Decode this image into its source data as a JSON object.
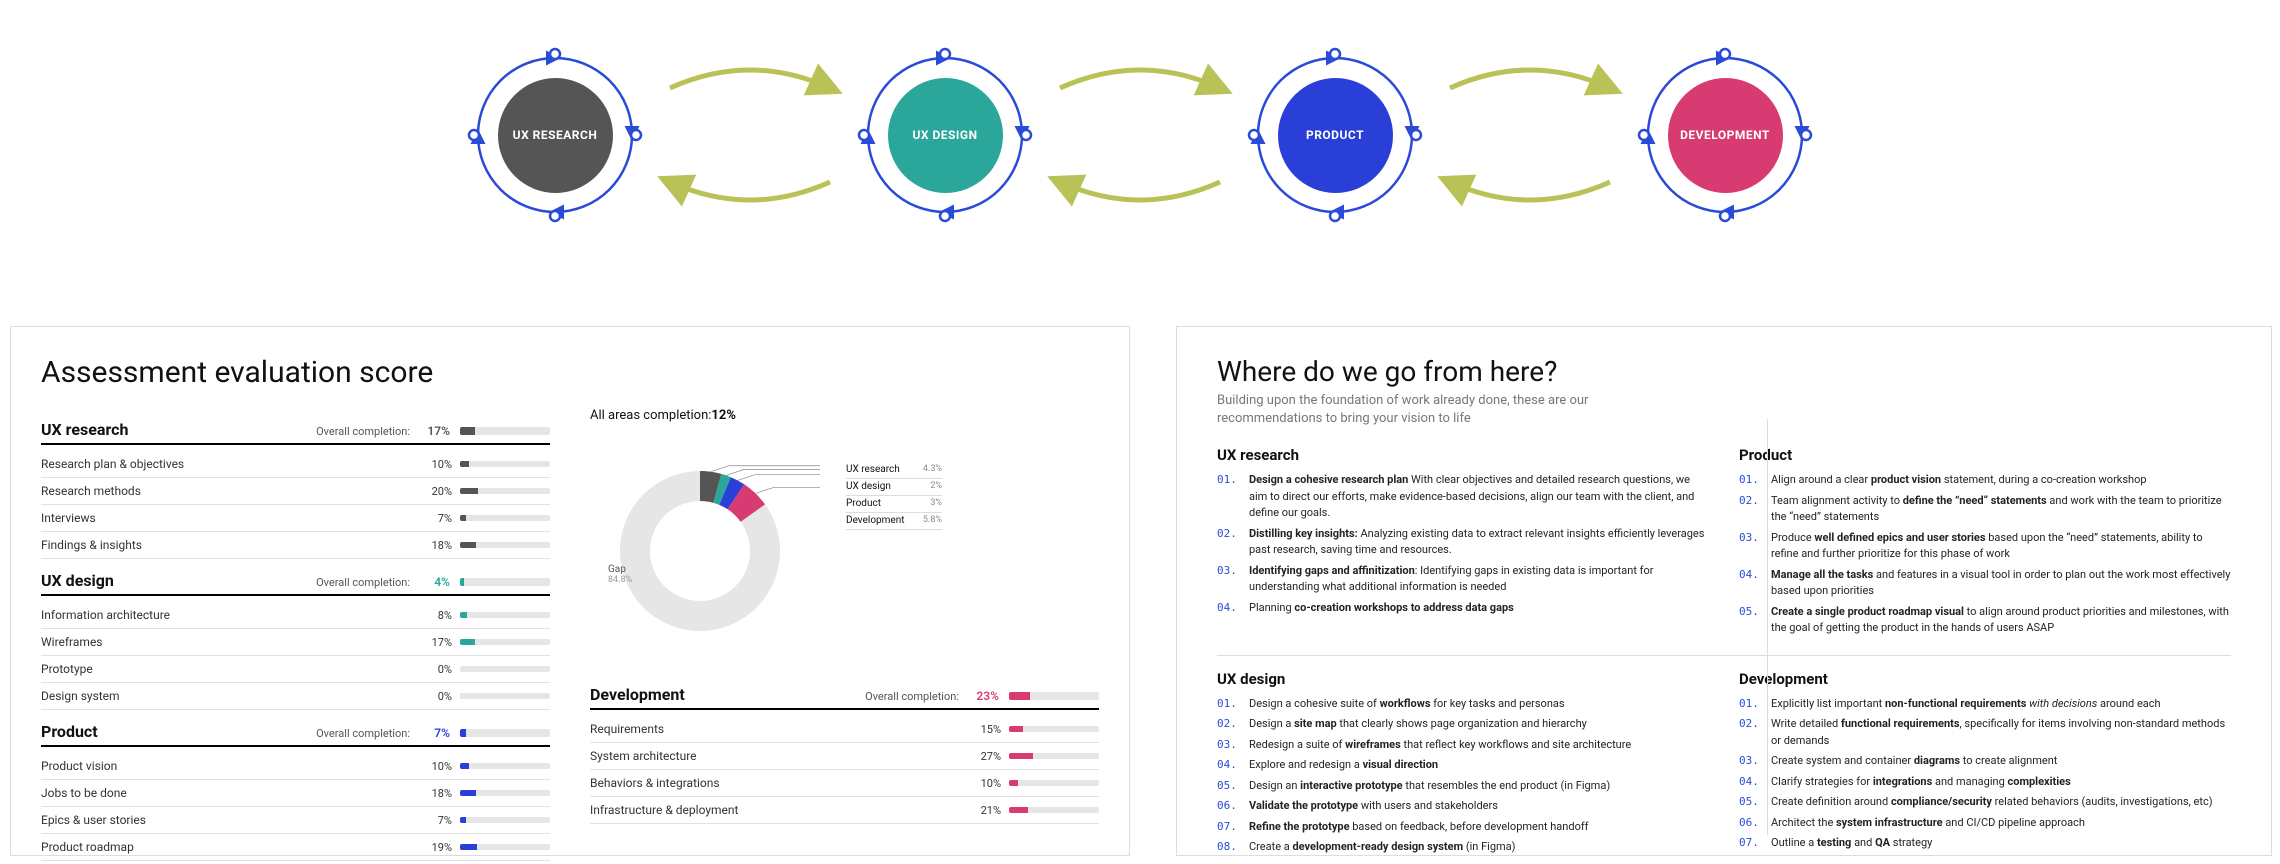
{
  "flow": {
    "stages": [
      {
        "label": "UX RESEARCH",
        "color": "#555555"
      },
      {
        "label": "UX DESIGN",
        "color": "#2aa79a"
      },
      {
        "label": "PRODUCT",
        "color": "#2a3fd8"
      },
      {
        "label": "DEVELOPMENT",
        "color": "#d83a72"
      }
    ],
    "orbit_color": "#2a4bd8",
    "connector_color": "#b8c257"
  },
  "assessment": {
    "title": "Assessment evaluation score",
    "overall_label": "Overall completion:",
    "categories": [
      {
        "name": "UX research",
        "overall": 17,
        "color": "#555555",
        "rows": [
          {
            "name": "Research plan & objectives",
            "pct": 10
          },
          {
            "name": "Research methods",
            "pct": 20
          },
          {
            "name": "Interviews",
            "pct": 7
          },
          {
            "name": "Findings & insights",
            "pct": 18
          }
        ]
      },
      {
        "name": "UX design",
        "overall": 4,
        "color": "#2aa79a",
        "rows": [
          {
            "name": "Information architecture",
            "pct": 8
          },
          {
            "name": "Wireframes",
            "pct": 17
          },
          {
            "name": "Prototype",
            "pct": 0
          },
          {
            "name": "Design system",
            "pct": 0
          }
        ]
      },
      {
        "name": "Product",
        "overall": 7,
        "color": "#2a3fd8",
        "rows": [
          {
            "name": "Product vision",
            "pct": 10
          },
          {
            "name": "Jobs to be done",
            "pct": 18
          },
          {
            "name": "Epics & user stories",
            "pct": 7
          },
          {
            "name": "Product roadmap",
            "pct": 19
          }
        ]
      },
      {
        "name": "Development",
        "overall": 23,
        "color": "#d83a72",
        "rows": [
          {
            "name": "Requirements",
            "pct": 15
          },
          {
            "name": "System architecture",
            "pct": 27
          },
          {
            "name": "Behaviors & integrations",
            "pct": 10
          },
          {
            "name": "Infrastructure & deployment",
            "pct": 21
          }
        ]
      }
    ]
  },
  "chart_data": {
    "type": "pie",
    "title": "All areas completion:12%",
    "slices": [
      {
        "name": "UX research",
        "value": 4.3,
        "color": "#555555"
      },
      {
        "name": "UX design",
        "value": 2.0,
        "color": "#2aa79a"
      },
      {
        "name": "Product",
        "value": 3.0,
        "color": "#2a3fd8"
      },
      {
        "name": "Development",
        "value": 5.8,
        "color": "#d83a72"
      },
      {
        "name": "Gap",
        "value": 84.8,
        "color": "#e6e6e6"
      }
    ],
    "gap_label": "Gap",
    "gap_value": "84.8%"
  },
  "recommendations": {
    "title": "Where do we go from here?",
    "subtitle": "Building upon the foundation of work already done, these are our recommendations to bring your vision to life",
    "blocks": [
      {
        "name": "UX research",
        "items": [
          "<b>Design a cohesive research plan</b> With clear objectives and detailed research questions, we aim to direct our efforts, make evidence-based decisions, align our team with the client, and define our goals.",
          "<b>Distilling key insights:</b> Analyzing existing data to extract relevant insights efficiently leverages past research, saving time and resources.",
          "<b>Identifying gaps and affinitization</b>: Identifying gaps in existing data is important for understanding what additional information is needed",
          "Planning <b>co-creation workshops to address data gaps</b>"
        ]
      },
      {
        "name": "Product",
        "items": [
          "Align around a clear <b>product vision</b> statement, during a co-creation workshop",
          "Team alignment activity to <b>define the “need” statements</b> and work with the team to prioritize the “need” statements",
          "Produce <b>well defined epics and user stories</b> based upon the “need” statements, ability to refine and further prioritize for this phase of work",
          "<b>Manage all the tasks</b> and features in a visual tool in order to plan out the work most effectively based upon priorities",
          "<b>Create a single product roadmap visual</b> to align around product priorities and milestones, with the goal of getting the product in the hands of users ASAP"
        ]
      },
      {
        "name": "UX design",
        "items": [
          "Design a cohesive suite of <b>workflows</b> for key tasks and personas",
          "Design a <b>site map</b> that clearly shows page organization and hierarchy",
          "Redesign a suite of <b>wireframes</b> that reflect key workflows and site architecture",
          "Explore and redesign a <b>visual direction</b>",
          "Design an <b>interactive prototype</b> that resembles the end product (in Figma)",
          "<b>Validate the prototype</b> with users and stakeholders",
          "<b>Refine the prototype</b> based on feedback, before development handoff",
          "Create a <b>development-ready design system</b> (in Figma)"
        ]
      },
      {
        "name": "Development",
        "items": [
          "Explicitly list important <b>non-functional requirements</b> <i>with decisions</i> around each",
          "Write detailed <b>functional requirements</b>, specifically for items involving non-standard methods or demands",
          "Create system and container <b>diagrams</b> to create alignment",
          "Clarify strategies for <b>integrations</b> and managing <b>complexities</b>",
          "Create definition around <b>compliance/security</b> related behaviors (audits, investigations, etc)",
          "Architect the <b>system infrastructure</b> and CI/CD pipeline approach",
          "Outline a <b>testing</b> and <b>QA</b> strategy"
        ]
      }
    ]
  }
}
